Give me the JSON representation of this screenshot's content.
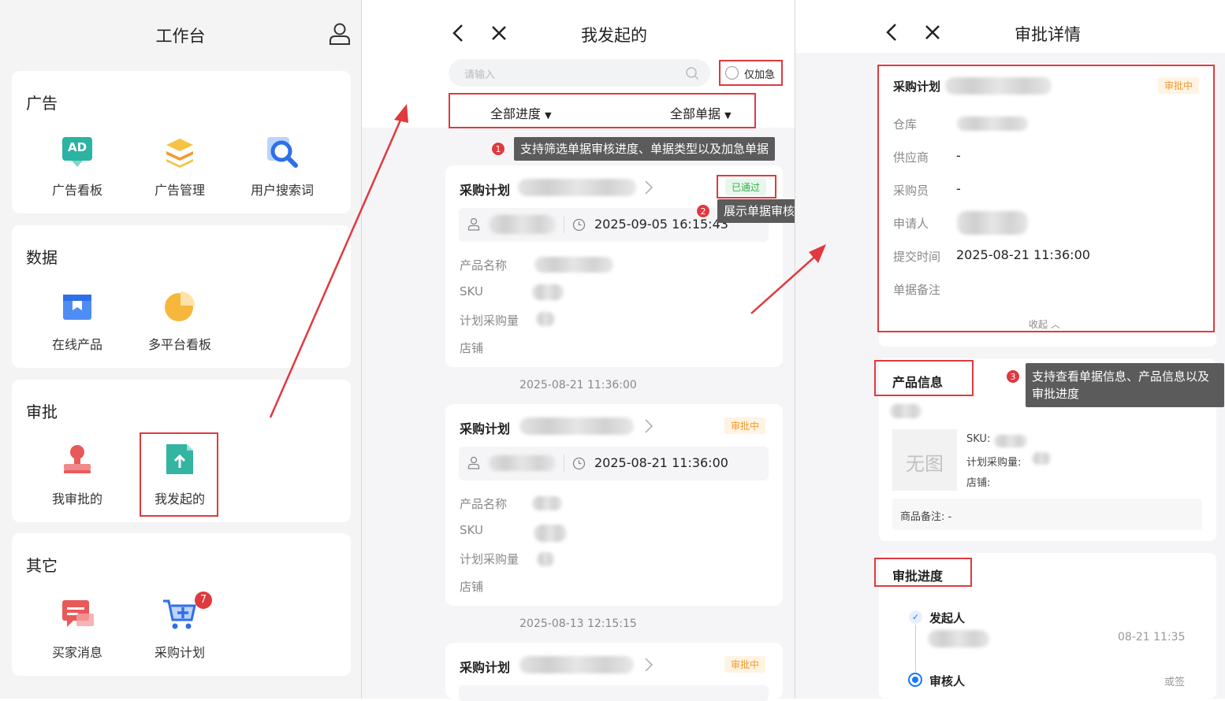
{
  "panel1": {
    "title": "工作台",
    "sections": [
      {
        "name": "广告",
        "items": [
          "广告看板",
          "广告管理",
          "用户搜索词"
        ]
      },
      {
        "name": "数据",
        "items": [
          "在线产品",
          "多平台看板"
        ]
      },
      {
        "name": "审批",
        "items": [
          "我审批的",
          "我发起的"
        ]
      },
      {
        "name": "其它",
        "items": [
          "买家消息",
          "采购计划"
        ]
      }
    ],
    "badge": "7",
    "ad_icon_text": "AD"
  },
  "panel2": {
    "title": "我发起的",
    "search_placeholder": "请输入",
    "urgent": "仅加急",
    "filter_progress": "全部进度",
    "filter_type": "全部单据",
    "tip1": "支持筛选单据审核进度、单据类型以及加急单据",
    "tip2": "展示单据审核状态",
    "orders": [
      {
        "title": "采购计划",
        "status": "已通过",
        "time": "2025-09-05 16:15:43"
      },
      {
        "title": "采购计划",
        "status": "审批中",
        "time": "2025-08-21 11:36:00"
      },
      {
        "title": "采购计划",
        "status": "审批中"
      }
    ],
    "fields": [
      "产品名称",
      "SKU",
      "计划采购量",
      "店铺"
    ],
    "dates": [
      "2025-08-21 11:36:00",
      "2025-08-13 12:15:15"
    ]
  },
  "panel3": {
    "title": "审批详情",
    "plan": "采购计划",
    "status": "审批中",
    "fields": [
      {
        "k": "仓库",
        "v": ""
      },
      {
        "k": "供应商",
        "v": "-"
      },
      {
        "k": "采购员",
        "v": "-"
      },
      {
        "k": "申请人",
        "v": ""
      },
      {
        "k": "提交时间",
        "v": "2025-08-21 11:36:00"
      },
      {
        "k": "单据备注",
        "v": ""
      }
    ],
    "collapse": "收起",
    "product_title": "产品信息",
    "noimg": "无图",
    "sku": "SKU:",
    "qty": "计划采购量:",
    "shop": "店铺:",
    "remark": "商品备注: -",
    "tip3": "支持查看单据信息、产品信息以及审批进度",
    "progress_title": "审批进度",
    "initiator": "发起人",
    "initiator_time": "08-21 11:35",
    "reviewer": "审核人",
    "reviewer_note": "或签"
  },
  "colors": {
    "red": "#e0393e",
    "blue": "#1677ff",
    "orange": "#f29a2e",
    "green": "#34b04d"
  }
}
